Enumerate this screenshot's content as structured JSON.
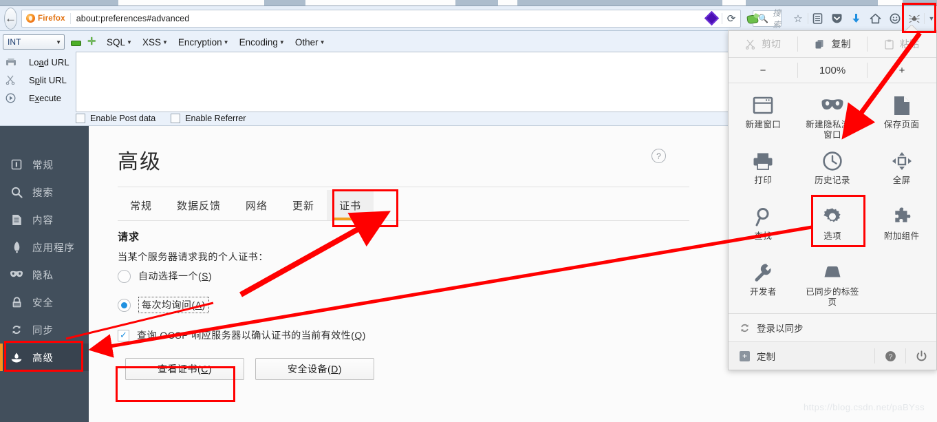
{
  "browser": {
    "back_button": "back-arrow",
    "brand_label": "Firefox",
    "url": "about:preferences#advanced",
    "search_placeholder": "搜索",
    "toolbar_icons": [
      "star-icon",
      "reader-list-icon",
      "pocket-icon",
      "download-icon",
      "home-icon",
      "smiley-icon",
      "bug-icon",
      "chevron-down-icon"
    ],
    "menu_button": "hamburger-menu"
  },
  "hackbar": {
    "encoding_select": "INT",
    "menus": [
      "SQL",
      "XSS",
      "Encryption",
      "Encoding",
      "Other"
    ],
    "actions": [
      {
        "label_pre": "Lo",
        "accel": "a",
        "label_post": "d URL",
        "icon": "load-url-icon"
      },
      {
        "label_pre": "S",
        "accel": "p",
        "label_post": "lit URL",
        "icon": "split-url-icon"
      },
      {
        "label_pre": "E",
        "accel": "x",
        "label_post": "ecute",
        "icon": "execute-icon"
      }
    ],
    "textarea_value": "",
    "checkboxes": [
      {
        "label": "Enable Post data",
        "checked": false
      },
      {
        "label": "Enable Referrer",
        "checked": false
      }
    ]
  },
  "sidebar": {
    "items": [
      {
        "label": "常规",
        "icon": "general-icon",
        "active": false
      },
      {
        "label": "搜索",
        "icon": "search-icon",
        "active": false
      },
      {
        "label": "内容",
        "icon": "content-icon",
        "active": false
      },
      {
        "label": "应用程序",
        "icon": "applications-icon",
        "active": false
      },
      {
        "label": "隐私",
        "icon": "privacy-mask-icon",
        "active": false
      },
      {
        "label": "安全",
        "icon": "security-lock-icon",
        "active": false
      },
      {
        "label": "同步",
        "icon": "sync-icon",
        "active": false
      },
      {
        "label": "高级",
        "icon": "advanced-icon",
        "active": true
      }
    ]
  },
  "page": {
    "title": "高级",
    "help_icon": "help-question-icon",
    "tabs": [
      {
        "label": "常规",
        "active": false
      },
      {
        "label": "数据反馈",
        "active": false
      },
      {
        "label": "网络",
        "active": false
      },
      {
        "label": "更新",
        "active": false
      },
      {
        "label": "证书",
        "active": true
      }
    ],
    "section_title": "请求",
    "section_desc": "当某个服务器请求我的个人证书：",
    "radios": [
      {
        "text_pre": "自动选择一个(",
        "accel": "S",
        "text_post": ")",
        "selected": false
      },
      {
        "text_pre": "每次均询问(",
        "accel": "A",
        "text_post": ")",
        "selected": true
      }
    ],
    "checkbox": {
      "text_pre": "查询 OCSP 响应服务器以确认证书的当前有效性(",
      "accel": "Q",
      "text_post": ")",
      "checked": true
    },
    "buttons": [
      {
        "text_pre": "查看证书(",
        "accel": "C",
        "text_post": ")"
      },
      {
        "text_pre": "安全设备(",
        "accel": "D",
        "text_post": ")"
      }
    ]
  },
  "panel": {
    "edit_row": [
      {
        "label": "剪切",
        "icon": "scissors-icon",
        "disabled": true
      },
      {
        "label": "复制",
        "icon": "copy-icon",
        "disabled": false
      },
      {
        "label": "粘贴",
        "icon": "clipboard-icon",
        "disabled": true
      }
    ],
    "zoom": {
      "minus": "−",
      "level": "100%",
      "plus": "+"
    },
    "grid": [
      {
        "label": "新建窗口",
        "icon": "new-window-icon"
      },
      {
        "label": "新建隐私浏览窗口",
        "icon": "private-mask-icon"
      },
      {
        "label": "保存页面",
        "icon": "save-page-icon"
      },
      {
        "label": "打印",
        "icon": "printer-icon"
      },
      {
        "label": "历史记录",
        "icon": "history-clock-icon"
      },
      {
        "label": "全屏",
        "icon": "fullscreen-icon"
      },
      {
        "label": "查找",
        "icon": "find-magnifier-icon"
      },
      {
        "label": "选项",
        "icon": "gear-icon"
      },
      {
        "label": "附加组件",
        "icon": "puzzle-addons-icon"
      },
      {
        "label": "开发者",
        "icon": "wrench-developer-icon"
      },
      {
        "label": "已同步的标签页",
        "icon": "synced-tabs-icon"
      }
    ],
    "sync_label": "登录以同步",
    "customize_label": "定制",
    "footer_icons": [
      "help-circle-icon",
      "power-icon"
    ]
  },
  "annotations": {
    "watermark": "https://blog.csdn.net/paBYss",
    "highlight_color": "#ff0000"
  }
}
